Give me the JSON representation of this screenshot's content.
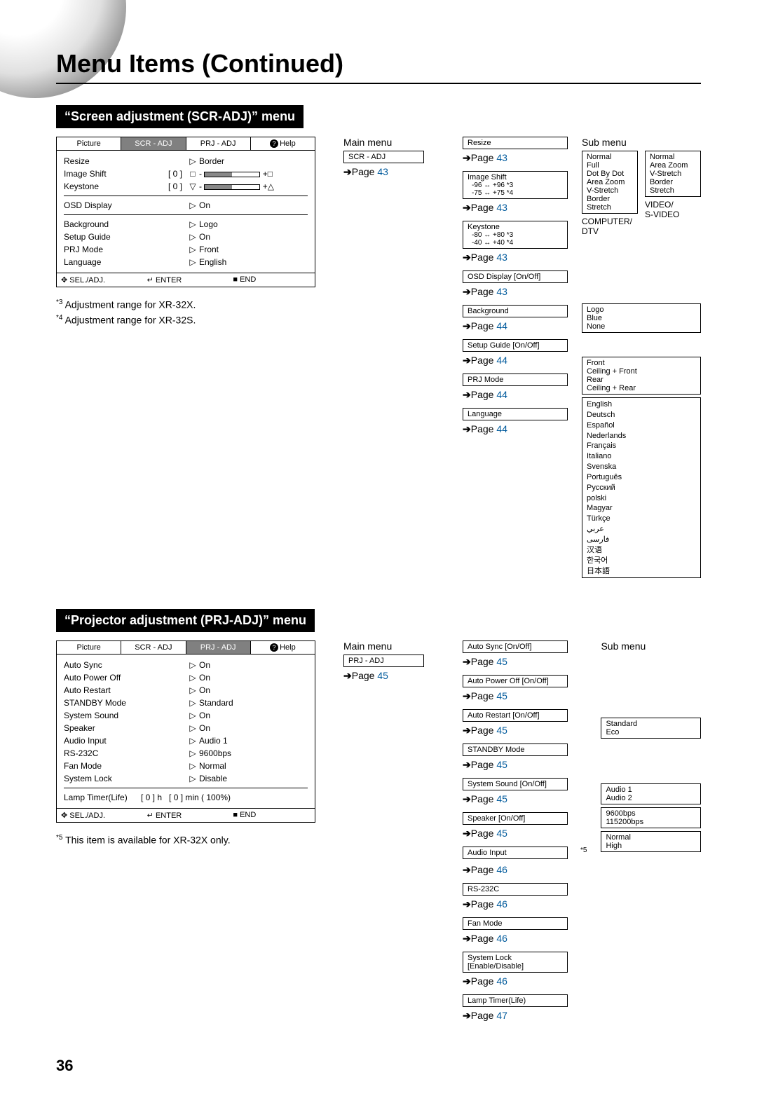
{
  "title": "Menu Items (Continued)",
  "page_number": "36",
  "sections": {
    "scr": {
      "header": "“Screen adjustment (SCR-ADJ)” menu",
      "osd": {
        "tabs": [
          "Picture",
          "SCR - ADJ",
          "PRJ - ADJ",
          "Help"
        ],
        "active_tab": "SCR - ADJ",
        "rows": [
          {
            "label": "Resize",
            "arrow": true,
            "val": "Border"
          },
          {
            "label": "Image Shift",
            "mid": "[      0 ]",
            "slidermark": "□",
            "plus": "+□"
          },
          {
            "label": "Keystone",
            "mid": "[      0 ]",
            "slidermark": "▽",
            "plus": "+△"
          },
          {
            "label": "OSD Display",
            "arrow": true,
            "val": "On",
            "divider_before": true
          },
          {
            "label": "Background",
            "arrow": true,
            "val": "Logo",
            "divider_before": true
          },
          {
            "label": "Setup Guide",
            "arrow": true,
            "val": "On"
          },
          {
            "label": "PRJ Mode",
            "arrow": true,
            "val": "Front"
          },
          {
            "label": "Language",
            "arrow": true,
            "val": "English"
          }
        ],
        "footer": [
          "SEL./ADJ.",
          "ENTER",
          "END"
        ],
        "footer_icons": [
          "✥",
          "↵",
          "■"
        ]
      },
      "footnotes": [
        {
          "sup": "*3",
          "text": " Adjustment range for XR-32X."
        },
        {
          "sup": "*4",
          "text": " Adjustment range for XR-32S."
        }
      ],
      "tree": {
        "main_label": "Main menu",
        "sub_label": "Sub menu",
        "main_box": "SCR - ADJ",
        "main_page": {
          "label": "Page ",
          "num": "43"
        },
        "items": [
          {
            "box": "Resize",
            "page": "43",
            "dual_sub": {
              "left": {
                "items": [
                  "Normal",
                  "Full",
                  "Dot By Dot",
                  "Area Zoom",
                  "V-Stretch",
                  "Border",
                  "Stretch"
                ],
                "note": "COMPUTER/\nDTV"
              },
              "right": {
                "items": [
                  "Normal",
                  "Area Zoom",
                  "V-Stretch",
                  "Border",
                  "Stretch"
                ],
                "note": "VIDEO/\nS-VIDEO"
              }
            }
          },
          {
            "box": "Image Shift",
            "extra": [
              "-96 ↔ +96 *3",
              "-75 ↔ +75 *4"
            ],
            "page": "43"
          },
          {
            "box": "Keystone",
            "extra": [
              "-80 ↔ +80 *3",
              "-40 ↔ +40 *4"
            ],
            "page": "43"
          },
          {
            "box": "OSD Display [On/Off]",
            "page": "43"
          },
          {
            "box": "Background",
            "page": "44",
            "sub": [
              "Logo",
              "Blue",
              "None"
            ]
          },
          {
            "box": "Setup Guide [On/Off]",
            "page": "44"
          },
          {
            "box": "PRJ Mode",
            "page": "44",
            "sub": [
              "Front",
              "Ceiling + Front",
              "Rear",
              "Ceiling + Rear"
            ]
          },
          {
            "box": "Language",
            "page": "44",
            "lang": [
              "English",
              "Deutsch",
              "Español",
              "Nederlands",
              "Français",
              "Italiano",
              "Svenska",
              "Português",
              "Русский",
              "polski",
              "Magyar",
              "Türkçe",
              "عربي",
              "فارسی",
              "汉语",
              "한국어",
              "日本語"
            ]
          }
        ]
      }
    },
    "prj": {
      "header": "“Projector adjustment (PRJ-ADJ)” menu",
      "osd": {
        "tabs": [
          "Picture",
          "SCR - ADJ",
          "PRJ - ADJ",
          "Help"
        ],
        "active_tab": "PRJ - ADJ",
        "rows": [
          {
            "label": "Auto Sync",
            "arrow": true,
            "val": "On"
          },
          {
            "label": "Auto Power Off",
            "arrow": true,
            "val": "On"
          },
          {
            "label": "Auto Restart",
            "arrow": true,
            "val": "On"
          },
          {
            "label": "STANDBY Mode",
            "arrow": true,
            "val": "Standard"
          },
          {
            "label": "System Sound",
            "arrow": true,
            "val": "On"
          },
          {
            "label": "Speaker",
            "arrow": true,
            "val": "On"
          },
          {
            "label": "Audio Input",
            "arrow": true,
            "val": "Audio 1"
          },
          {
            "label": "RS-232C",
            "arrow": true,
            "val": "9600bps"
          },
          {
            "label": "Fan Mode",
            "arrow": true,
            "val": "Normal"
          },
          {
            "label": "System Lock",
            "arrow": true,
            "val": "Disable"
          }
        ],
        "lamp_row": {
          "label": "Lamp Timer(Life)",
          "h": "[      0 ] h",
          "min": "[      0 ] min ( 100%)"
        },
        "footer": [
          "SEL./ADJ.",
          "ENTER",
          "END"
        ],
        "footer_icons": [
          "✥",
          "↵",
          "■"
        ]
      },
      "footnotes": [
        {
          "sup": "*5",
          "text": " This item is available for XR-32X only."
        }
      ],
      "tree": {
        "main_label": "Main menu",
        "sub_label": "Sub menu",
        "main_box": "PRJ - ADJ",
        "main_page": {
          "label": "Page ",
          "num": "45"
        },
        "items": [
          {
            "box": "Auto Sync [On/Off]",
            "page": "45"
          },
          {
            "box": "Auto Power Off [On/Off]",
            "page": "45"
          },
          {
            "box": "Auto Restart [On/Off]",
            "page": "45"
          },
          {
            "box": "STANDBY Mode",
            "page": "45",
            "sub": [
              "Standard",
              "Eco"
            ]
          },
          {
            "box": "System Sound [On/Off]",
            "page": "45"
          },
          {
            "box": "Speaker [On/Off]",
            "page": "45"
          },
          {
            "box": "Audio Input",
            "page": "46",
            "note_after_box": "*5",
            "sub": [
              "Audio 1",
              "Audio 2"
            ]
          },
          {
            "box": "RS-232C",
            "page": "46",
            "sub": [
              "9600bps",
              "115200bps"
            ]
          },
          {
            "box": "Fan Mode",
            "page": "46",
            "sub": [
              "Normal",
              "High"
            ]
          },
          {
            "box": "System Lock\n[Enable/Disable]",
            "page": "46"
          },
          {
            "box": "Lamp Timer(Life)",
            "page": "47"
          }
        ]
      }
    }
  }
}
